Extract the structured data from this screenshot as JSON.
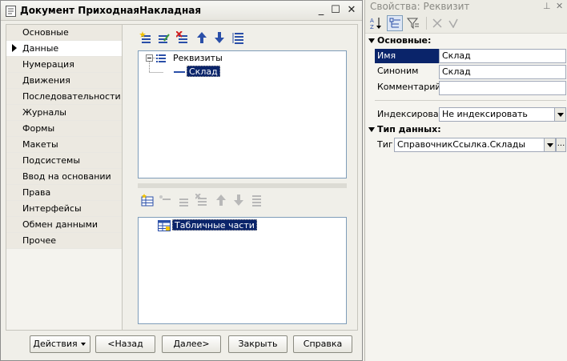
{
  "window": {
    "title": "Документ ПриходнаяНакладная",
    "minimize_glyph": "_",
    "maximize_glyph": "☐",
    "close_glyph": "✕"
  },
  "tabs": [
    {
      "label": "Основные",
      "active": false
    },
    {
      "label": "Данные",
      "active": true
    },
    {
      "label": "Нумерация",
      "active": false
    },
    {
      "label": "Движения",
      "active": false
    },
    {
      "label": "Последовательности",
      "active": false
    },
    {
      "label": "Журналы",
      "active": false
    },
    {
      "label": "Формы",
      "active": false
    },
    {
      "label": "Макеты",
      "active": false
    },
    {
      "label": "Подсистемы",
      "active": false
    },
    {
      "label": "Ввод на основании",
      "active": false
    },
    {
      "label": "Права",
      "active": false
    },
    {
      "label": "Интерфейсы",
      "active": false
    },
    {
      "label": "Обмен данными",
      "active": false
    },
    {
      "label": "Прочее",
      "active": false
    }
  ],
  "attributes_tree": {
    "root_label": "Реквизиты",
    "children": [
      "Склад"
    ]
  },
  "tabular_tree": {
    "root_label": "Табличные части"
  },
  "buttons": {
    "actions": "Действия",
    "back": "<Назад",
    "next": "Далее>",
    "close": "Закрыть",
    "help": "Справка"
  },
  "properties": {
    "title": "Свойства: Реквизит",
    "pin_glyph": "⊥",
    "close_glyph": "✕",
    "section_main": "Основные:",
    "name_label": "Имя",
    "name_value": "Склад",
    "synonym_label": "Синоним",
    "synonym_value": "Склад",
    "comment_label": "Комментарий",
    "comment_value": "",
    "index_label": "Индексировать",
    "index_value": "Не индексировать",
    "section_type": "Тип данных:",
    "type_label": "Тип",
    "type_value": "СправочникСсылка.Склады",
    "type_more": "..."
  },
  "colors": {
    "selection": "#0a246a",
    "toolbar_blue": "#2a4fa8"
  }
}
